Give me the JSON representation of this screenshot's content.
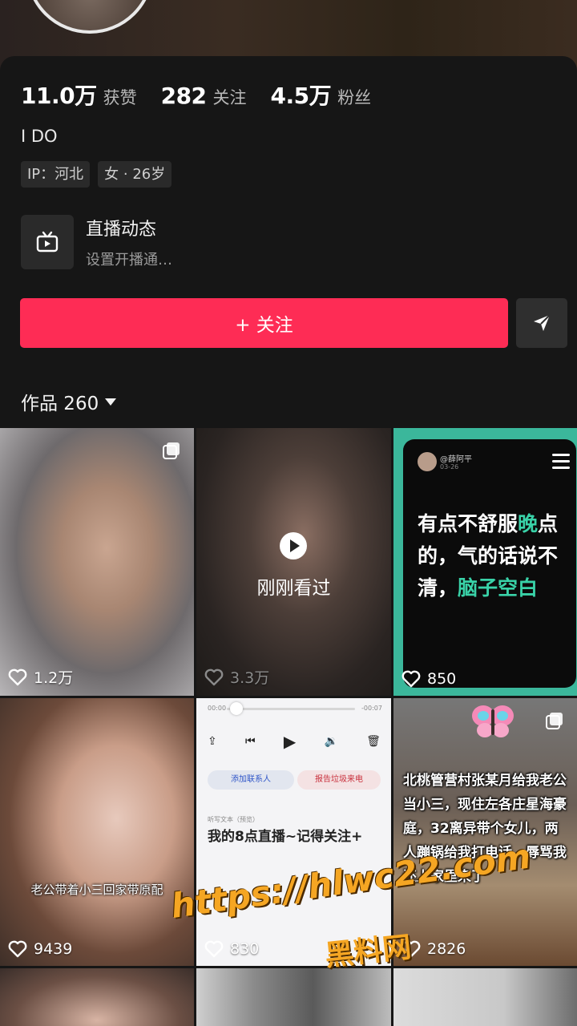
{
  "profile": {
    "stats": [
      {
        "value": "11.0万",
        "label": "获赞"
      },
      {
        "value": "282",
        "label": "关注"
      },
      {
        "value": "4.5万",
        "label": "粉丝"
      }
    ],
    "nickname": "I DO",
    "tags": [
      "IP：河北",
      "女 · 26岁"
    ],
    "live": {
      "title": "直播动态",
      "subtitle": "设置开播通…"
    },
    "follow_label": "+ 关注",
    "works_label": "作品 260"
  },
  "grid": [
    {
      "likes": "1.2万"
    },
    {
      "likes": "3.3万",
      "overlay": "刚刚看过"
    },
    {
      "likes": "850",
      "card_user": "@薛阿平",
      "card_date": "03-26",
      "card_text_1": "有点不舒服",
      "card_text_2": "晚",
      "card_text_3": "点的，气的话说不清，",
      "card_text_4": "脑子空白"
    },
    {
      "likes": "9439",
      "caption": "老公带着小三回家带原配"
    },
    {
      "likes": "830",
      "audio_start": "00:00",
      "audio_end": "-00:07",
      "pill_a": "添加联系人",
      "pill_b": "报告垃圾来电",
      "transcript_label": "听写文本（预览）",
      "transcript": "我的8点直播~记得关注+"
    },
    {
      "likes": "2826",
      "caption": "北桃管营村张某月给我老公当小三，现住左各庄星海豪庭，32离异带个女儿，两人蹦锅给我打电话，辱骂我还上家里来了"
    }
  ],
  "watermark": {
    "url": "https://hlwc22.com",
    "name": "黑料网",
    "color": "#f5a623"
  },
  "colors": {
    "accent": "#fe2c55",
    "background": "#161616"
  }
}
